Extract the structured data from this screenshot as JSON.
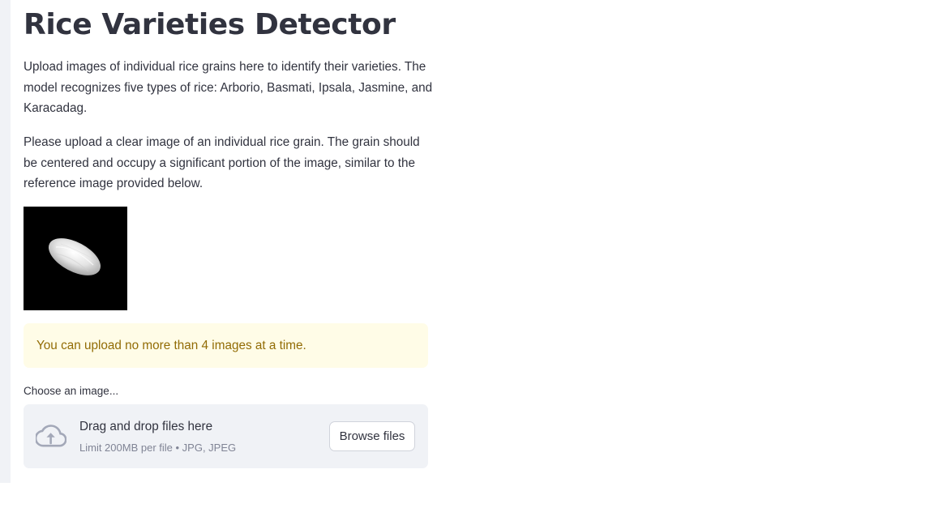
{
  "app": {
    "title": "Rice Varieties Detector"
  },
  "intro": {
    "paragraph1": "Upload images of individual rice grains here to identify their varieties. The model recognizes five types of rice: Arborio, Basmati, Ipsala, Jasmine, and Karacadag.",
    "paragraph2": "Please upload a clear image of an individual rice grain. The grain should be centered and occupy a significant portion of the image, similar to the reference image provided below."
  },
  "reference_image": {
    "description": "rice-grain-reference"
  },
  "warning": {
    "text": "You can upload no more than 4 images at a time.",
    "background_color": "#fffce7",
    "text_color": "#926c05"
  },
  "uploader": {
    "label": "Choose an image...",
    "drop_text": "Drag and drop files here",
    "limit_text": "Limit 200MB per file • JPG, JPEG",
    "browse_label": "Browse files",
    "icon": "cloud-upload-icon"
  }
}
